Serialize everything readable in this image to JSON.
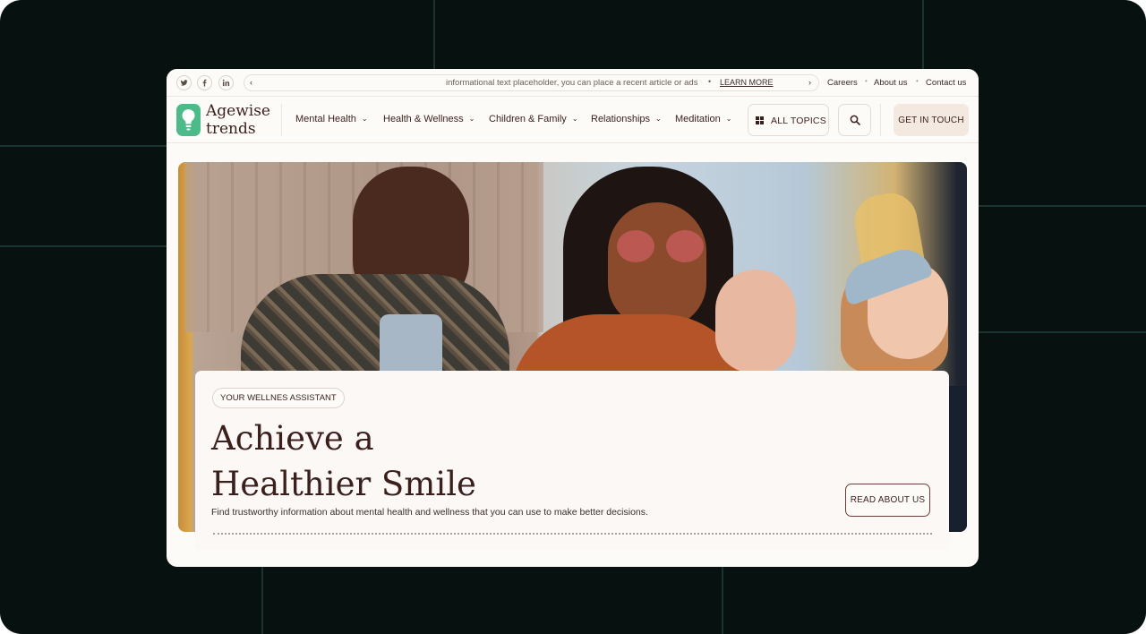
{
  "social": [
    {
      "name": "twitter-icon"
    },
    {
      "name": "facebook-icon"
    },
    {
      "name": "linkedin-icon"
    }
  ],
  "ticker": {
    "text": "informational text placeholder, you can place a recent article or ads",
    "separator": "•",
    "link": "LEARN MORE"
  },
  "top_links": [
    "Careers",
    "About us",
    "Contact us"
  ],
  "top_link_separator": "•",
  "brand": {
    "line1": "Agewise",
    "line2": "trends",
    "color": "#4dba8a"
  },
  "nav": {
    "items": [
      "Mental Health",
      "Health & Wellness",
      "Children & Family",
      "Relationships",
      "Meditation"
    ],
    "all_topics": "ALL TOPICS",
    "cta": "GET IN TOUCH"
  },
  "hero": {
    "badge": "YOUR WELLNES ASSISTANT",
    "title_line1": "Achieve a",
    "title_line2": "Healthier Smile",
    "subtitle": "Find trustworthy information about mental health and wellness that you can use to make better decisions.",
    "button": "READ ABOUT US"
  },
  "colors": {
    "frame_bg": "#061110",
    "text_dark": "#3b1f1c",
    "cta_bg": "#f3e9e0",
    "page_bg": "#fdfbf8"
  }
}
